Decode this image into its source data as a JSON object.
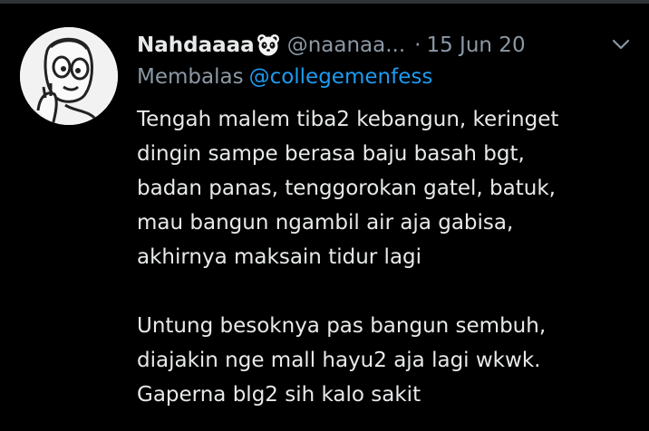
{
  "tweet": {
    "author_name": "Nahdaaaa",
    "author_emoji": "panda-icon",
    "author_handle": "@naanaa...",
    "separator": "·",
    "date": "15 Jun 20",
    "reply_label": "Membalas",
    "reply_mention": "@collegemenfess",
    "paragraph_1": [
      "Tengah malem tiba2 kebangun, keringet",
      "dingin sampe berasa baju basah bgt,",
      "badan panas, tenggorokan gatel, batuk,",
      "mau bangun ngambil air aja gabisa,",
      "akhirnya maksain tidur lagi"
    ],
    "paragraph_2": [
      "Untung besoknya pas bangun sembuh,",
      "diajakin nge mall hayu2 aja lagi wkwk.",
      "Gaperna blg2 sih kalo sakit"
    ]
  },
  "colors": {
    "background": "#000000",
    "text_primary": "#e7e9ea",
    "text_secondary": "#8b98a5",
    "accent": "#1d9bf0"
  },
  "icons": {
    "avatar": "cartoon-face-avatar",
    "more": "chevron-down-icon"
  }
}
